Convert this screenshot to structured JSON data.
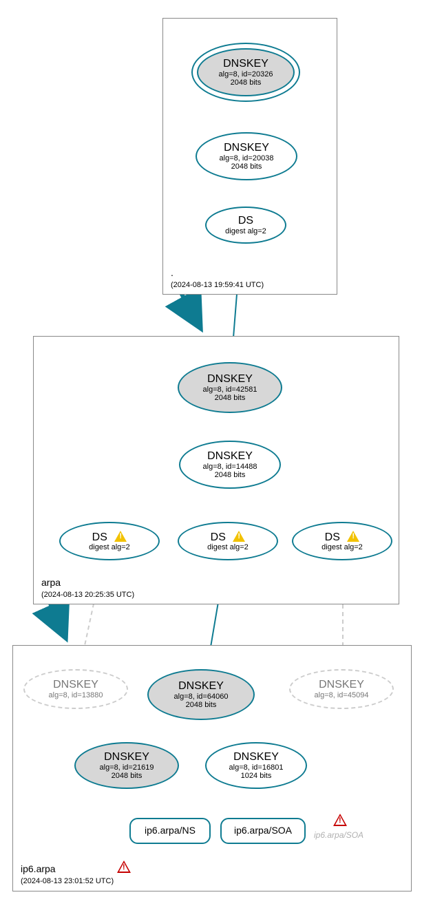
{
  "colors": {
    "teal": "#0e7b91",
    "grey_fill": "#d7d7d7",
    "zone_border": "#888888",
    "warn": "#f2c200",
    "error": "#c60000",
    "ghost": "#b0b0b0"
  },
  "zones": {
    "root": {
      "label": ".",
      "date": "(2024-08-13 19:59:41 UTC)"
    },
    "arpa": {
      "label": "arpa",
      "date": "(2024-08-13 20:25:35 UTC)"
    },
    "ip6arpa": {
      "label": "ip6.arpa",
      "date": "(2024-08-13 23:01:52 UTC)"
    }
  },
  "nodes": {
    "root_ksk": {
      "title": "DNSKEY",
      "sub1": "alg=8, id=20326",
      "sub2": "2048 bits"
    },
    "root_zsk": {
      "title": "DNSKEY",
      "sub1": "alg=8, id=20038",
      "sub2": "2048 bits"
    },
    "root_ds": {
      "title": "DS",
      "sub1": "digest alg=2"
    },
    "arpa_ksk": {
      "title": "DNSKEY",
      "sub1": "alg=8, id=42581",
      "sub2": "2048 bits"
    },
    "arpa_zsk": {
      "title": "DNSKEY",
      "sub1": "alg=8, id=14488",
      "sub2": "2048 bits"
    },
    "arpa_ds1": {
      "title": "DS",
      "title_icon": "warn",
      "sub1": "digest alg=2"
    },
    "arpa_ds2": {
      "title": "DS",
      "title_icon": "warn",
      "sub1": "digest alg=2"
    },
    "arpa_ds3": {
      "title": "DS",
      "title_icon": "warn",
      "sub1": "digest alg=2"
    },
    "ip6_missing1": {
      "title": "DNSKEY",
      "sub1": "alg=8, id=13880"
    },
    "ip6_ksk": {
      "title": "DNSKEY",
      "sub1": "alg=8, id=64060",
      "sub2": "2048 bits"
    },
    "ip6_missing2": {
      "title": "DNSKEY",
      "sub1": "alg=8, id=45094"
    },
    "ip6_zsk1": {
      "title": "DNSKEY",
      "sub1": "alg=8, id=21619",
      "sub2": "2048 bits"
    },
    "ip6_zsk2": {
      "title": "DNSKEY",
      "sub1": "alg=8, id=16801",
      "sub2": "1024 bits"
    },
    "ip6_ns": {
      "title": "ip6.arpa/NS"
    },
    "ip6_soa": {
      "title": "ip6.arpa/SOA"
    }
  },
  "ghost_soa_label": "ip6.arpa/SOA",
  "zone_error_icon": "error",
  "floating_error_icon": "error",
  "chart_data": {
    "type": "tree",
    "description": "DNSSEC authentication chain / DNSViz-style diagram for ip6.arpa",
    "zones": [
      {
        "name": ".",
        "analyzed_at": "2024-08-13 19:59:41 UTC",
        "keys": [
          {
            "role": "KSK",
            "type": "DNSKEY",
            "alg": 8,
            "id": 20326,
            "bits": 2048,
            "self_signed": true,
            "trust_anchor": true
          },
          {
            "role": "ZSK",
            "type": "DNSKEY",
            "alg": 8,
            "id": 20038,
            "bits": 2048
          }
        ],
        "ds_to_child": [
          {
            "type": "DS",
            "digest_alg": 2,
            "child_zone": "arpa",
            "status": "ok"
          }
        ]
      },
      {
        "name": "arpa",
        "analyzed_at": "2024-08-13 20:25:35 UTC",
        "keys": [
          {
            "role": "KSK",
            "type": "DNSKEY",
            "alg": 8,
            "id": 42581,
            "bits": 2048,
            "self_signed": true
          },
          {
            "role": "ZSK",
            "type": "DNSKEY",
            "alg": 8,
            "id": 14488,
            "bits": 2048
          }
        ],
        "ds_to_child": [
          {
            "type": "DS",
            "digest_alg": 2,
            "child_zone": "ip6.arpa",
            "status": "warning",
            "matches_key_id": 13880
          },
          {
            "type": "DS",
            "digest_alg": 2,
            "child_zone": "ip6.arpa",
            "status": "warning",
            "matches_key_id": 64060
          },
          {
            "type": "DS",
            "digest_alg": 2,
            "child_zone": "ip6.arpa",
            "status": "warning",
            "matches_key_id": 45094
          }
        ]
      },
      {
        "name": "ip6.arpa",
        "analyzed_at": "2024-08-13 23:01:52 UTC",
        "zone_status": "error",
        "keys": [
          {
            "role": "KSK_missing",
            "type": "DNSKEY",
            "alg": 8,
            "id": 13880,
            "present": false
          },
          {
            "role": "KSK",
            "type": "DNSKEY",
            "alg": 8,
            "id": 64060,
            "bits": 2048,
            "self_signed": true
          },
          {
            "role": "KSK_missing",
            "type": "DNSKEY",
            "alg": 8,
            "id": 45094,
            "present": false
          },
          {
            "role": "ZSK",
            "type": "DNSKEY",
            "alg": 8,
            "id": 21619,
            "bits": 2048,
            "self_signed": true
          },
          {
            "role": "ZSK",
            "type": "DNSKEY",
            "alg": 8,
            "id": 16801,
            "bits": 1024
          }
        ],
        "rrsets": [
          {
            "name": "ip6.arpa/NS",
            "signed_by": 16801,
            "status": "ok"
          },
          {
            "name": "ip6.arpa/SOA",
            "signed_by": 16801,
            "status": "ok"
          },
          {
            "name": "ip6.arpa/SOA",
            "status": "error",
            "note": "response error"
          }
        ]
      }
    ],
    "edges": [
      {
        "from": ".KSK20326",
        "to": ".KSK20326",
        "kind": "self-loop"
      },
      {
        "from": ".KSK20326",
        "to": ".ZSK20038",
        "kind": "signs"
      },
      {
        "from": ".ZSK20038",
        "to": ".DS(arpa)",
        "kind": "signs"
      },
      {
        "from": ".DS(arpa)",
        "to": "arpa.KSK42581",
        "kind": "delegation"
      },
      {
        "from": "arpa.KSK42581",
        "to": "arpa.KSK42581",
        "kind": "self-loop"
      },
      {
        "from": "arpa.KSK42581",
        "to": "arpa.ZSK14488",
        "kind": "signs"
      },
      {
        "from": "arpa.ZSK14488",
        "to": "arpa.DS1",
        "kind": "signs"
      },
      {
        "from": "arpa.ZSK14488",
        "to": "arpa.DS2",
        "kind": "signs"
      },
      {
        "from": "arpa.ZSK14488",
        "to": "arpa.DS3",
        "kind": "signs"
      },
      {
        "from": "arpa.DS1",
        "to": "ip6.DNSKEY13880",
        "kind": "delegation-missing"
      },
      {
        "from": "arpa.DS2",
        "to": "ip6.KSK64060",
        "kind": "delegation"
      },
      {
        "from": "arpa.DS3",
        "to": "ip6.DNSKEY45094",
        "kind": "delegation-missing"
      },
      {
        "from": "ip6.KSK64060",
        "to": "ip6.KSK64060",
        "kind": "self-loop"
      },
      {
        "from": "ip6.KSK64060",
        "to": "ip6.ZSK21619",
        "kind": "signs"
      },
      {
        "from": "ip6.KSK64060",
        "to": "ip6.ZSK16801",
        "kind": "signs"
      },
      {
        "from": "ip6.ZSK21619",
        "to": "ip6.ZSK21619",
        "kind": "self-loop"
      },
      {
        "from": "ip6.ZSK16801",
        "to": "ip6.arpa/NS",
        "kind": "signs"
      },
      {
        "from": "ip6.ZSK16801",
        "to": "ip6.arpa/SOA",
        "kind": "signs"
      }
    ]
  }
}
